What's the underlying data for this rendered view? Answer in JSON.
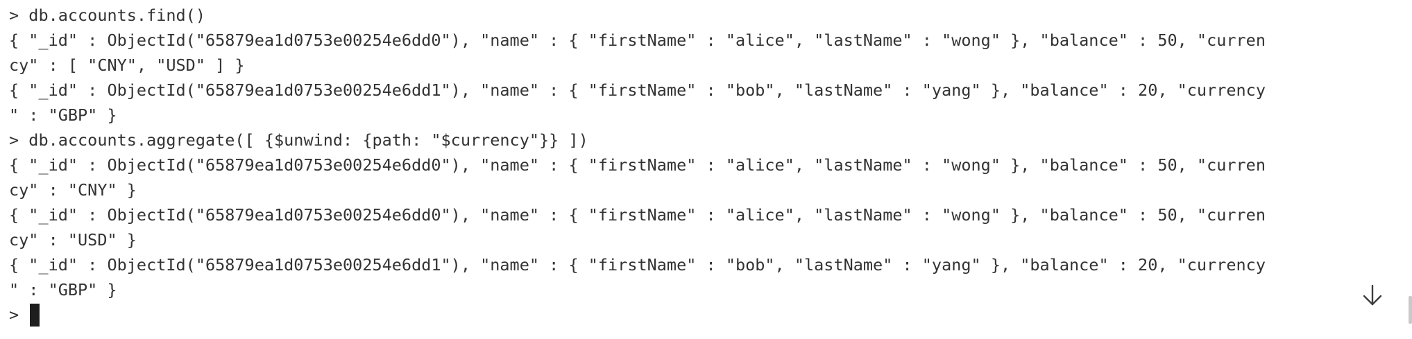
{
  "terminal": {
    "lines": [
      "> db.accounts.find()",
      "{ \"_id\" : ObjectId(\"65879ea1d0753e00254e6dd0\"), \"name\" : { \"firstName\" : \"alice\", \"lastName\" : \"wong\" }, \"balance\" : 50, \"curren",
      "cy\" : [ \"CNY\", \"USD\" ] }",
      "{ \"_id\" : ObjectId(\"65879ea1d0753e00254e6dd1\"), \"name\" : { \"firstName\" : \"bob\", \"lastName\" : \"yang\" }, \"balance\" : 20, \"currency",
      "\" : \"GBP\" }",
      "> db.accounts.aggregate([ {$unwind: {path: \"$currency\"}} ])",
      "{ \"_id\" : ObjectId(\"65879ea1d0753e00254e6dd0\"), \"name\" : { \"firstName\" : \"alice\", \"lastName\" : \"wong\" }, \"balance\" : 50, \"curren",
      "cy\" : \"CNY\" }",
      "{ \"_id\" : ObjectId(\"65879ea1d0753e00254e6dd0\"), \"name\" : { \"firstName\" : \"alice\", \"lastName\" : \"wong\" }, \"balance\" : 50, \"curren",
      "cy\" : \"USD\" }",
      "{ \"_id\" : ObjectId(\"65879ea1d0753e00254e6dd1\"), \"name\" : { \"firstName\" : \"bob\", \"lastName\" : \"yang\" }, \"balance\" : 20, \"currency",
      "\" : \"GBP\" }"
    ],
    "prompt": ">",
    "scroll_button_icon": "arrow-down-icon",
    "text_color": "#333333",
    "cursor_color": "#1e1e1e"
  }
}
